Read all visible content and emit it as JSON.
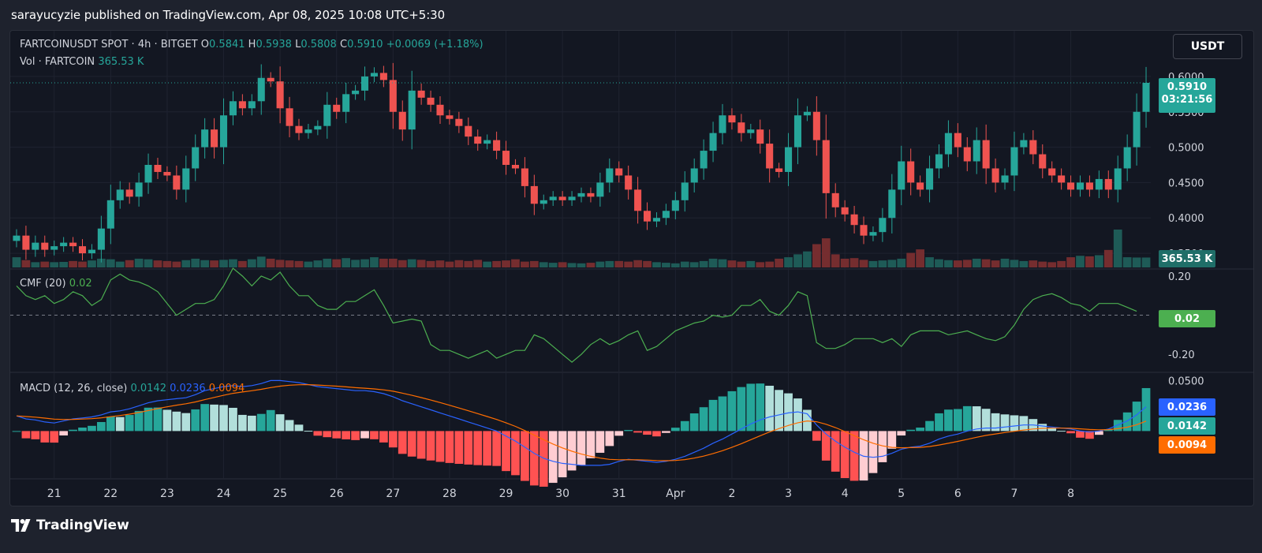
{
  "header": {
    "publisher_line": "sarayucyzie published on TradingView.com, Apr 08, 2025 10:08 UTC+5:30"
  },
  "legend": {
    "symbol": "FARTCOINUSDT SPOT · 4h · BITGET",
    "o_label": "O",
    "o_value": "0.5841",
    "h_label": "H",
    "h_value": "0.5938",
    "l_label": "L",
    "l_value": "0.5808",
    "c_label": "C",
    "c_value": "0.5910",
    "change": "+0.0069 (+1.18%)",
    "vol_label": "Vol · FARTCOIN",
    "vol_value": "365.53 K",
    "cmf_label": "CMF (20)",
    "cmf_value": "0.02",
    "macd_label": "MACD (12, 26, close)",
    "macd_value": "0.0142",
    "signal_value": "0.0236",
    "hist_value": "0.0094"
  },
  "currency_button": "USDT",
  "price_tag": {
    "price": "0.5910",
    "countdown": "03:21:56"
  },
  "volume_tag": "365.53 K",
  "cmf_tag": "0.02",
  "macd_tags": {
    "signal": "0.0236",
    "macd": "0.0142",
    "hist": "0.0094"
  },
  "colors": {
    "up": "#26a69a",
    "down": "#ef5350",
    "cmf": "#4caf50",
    "macd": "#2962ff",
    "signal": "#ff6d00",
    "background": "#131722"
  },
  "footer": {
    "brand": "TradingView"
  },
  "chart_data": [
    {
      "type": "candlestick",
      "title": "FARTCOINUSDT SPOT · 4h · BITGET",
      "y_ticks": [
        "0.6000",
        "0.5500",
        "0.5000",
        "0.4500",
        "0.4000",
        "0.3500"
      ],
      "ylim": [
        0.33,
        0.62
      ],
      "x_ticks": [
        "21",
        "22",
        "23",
        "24",
        "25",
        "26",
        "27",
        "28",
        "29",
        "30",
        "31",
        "Apr",
        "2",
        "3",
        "4",
        "5",
        "6",
        "7",
        "8"
      ],
      "closes": [
        0.375,
        0.355,
        0.365,
        0.355,
        0.36,
        0.365,
        0.36,
        0.35,
        0.355,
        0.385,
        0.425,
        0.44,
        0.43,
        0.45,
        0.475,
        0.465,
        0.46,
        0.44,
        0.47,
        0.5,
        0.525,
        0.5,
        0.545,
        0.565,
        0.555,
        0.565,
        0.598,
        0.593,
        0.555,
        0.53,
        0.52,
        0.525,
        0.53,
        0.56,
        0.55,
        0.575,
        0.58,
        0.6,
        0.605,
        0.595,
        0.55,
        0.525,
        0.58,
        0.57,
        0.56,
        0.545,
        0.54,
        0.53,
        0.515,
        0.505,
        0.51,
        0.495,
        0.475,
        0.47,
        0.445,
        0.42,
        0.425,
        0.43,
        0.425,
        0.43,
        0.435,
        0.43,
        0.45,
        0.47,
        0.46,
        0.44,
        0.41,
        0.395,
        0.4,
        0.41,
        0.425,
        0.45,
        0.47,
        0.495,
        0.52,
        0.545,
        0.535,
        0.52,
        0.525,
        0.505,
        0.47,
        0.465,
        0.5,
        0.545,
        0.55,
        0.51,
        0.435,
        0.415,
        0.405,
        0.39,
        0.375,
        0.38,
        0.4,
        0.44,
        0.48,
        0.45,
        0.44,
        0.47,
        0.49,
        0.52,
        0.5,
        0.48,
        0.51,
        0.47,
        0.45,
        0.46,
        0.5,
        0.51,
        0.49,
        0.47,
        0.46,
        0.45,
        0.44,
        0.45,
        0.44,
        0.455,
        0.44,
        0.47,
        0.5,
        0.55,
        0.591
      ]
    },
    {
      "type": "bar",
      "title": "Vol · FARTCOIN",
      "values": [
        0.35,
        0.25,
        0.18,
        0.2,
        0.18,
        0.19,
        0.22,
        0.2,
        0.24,
        0.3,
        0.28,
        0.2,
        0.25,
        0.3,
        0.28,
        0.24,
        0.22,
        0.2,
        0.25,
        0.3,
        0.25,
        0.24,
        0.26,
        0.28,
        0.22,
        0.28,
        0.37,
        0.3,
        0.26,
        0.24,
        0.22,
        0.2,
        0.24,
        0.3,
        0.28,
        0.32,
        0.26,
        0.28,
        0.35,
        0.3,
        0.3,
        0.25,
        0.28,
        0.26,
        0.22,
        0.24,
        0.2,
        0.25,
        0.22,
        0.26,
        0.2,
        0.22,
        0.24,
        0.28,
        0.2,
        0.22,
        0.18,
        0.16,
        0.18,
        0.15,
        0.14,
        0.16,
        0.2,
        0.22,
        0.22,
        0.2,
        0.25,
        0.22,
        0.18,
        0.16,
        0.14,
        0.2,
        0.18,
        0.22,
        0.3,
        0.28,
        0.24,
        0.2,
        0.22,
        0.18,
        0.2,
        0.3,
        0.35,
        0.45,
        0.55,
        0.8,
        1.0,
        0.45,
        0.3,
        0.32,
        0.26,
        0.22,
        0.24,
        0.26,
        0.3,
        0.5,
        0.62,
        0.35,
        0.28,
        0.25,
        0.24,
        0.26,
        0.3,
        0.28,
        0.24,
        0.3,
        0.26,
        0.22,
        0.24,
        0.2,
        0.18,
        0.22,
        0.35,
        0.4,
        0.38,
        0.42,
        0.6,
        1.3,
        0.35,
        0.34,
        0.34
      ]
    },
    {
      "type": "line",
      "title": "CMF (20)",
      "y_ticks": [
        "0.20",
        "-0.20"
      ],
      "ylim": [
        -0.28,
        0.22
      ],
      "values": [
        0.15,
        0.1,
        0.08,
        0.1,
        0.06,
        0.08,
        0.12,
        0.1,
        0.05,
        0.08,
        0.18,
        0.21,
        0.18,
        0.17,
        0.15,
        0.12,
        0.06,
        0.0,
        0.03,
        0.06,
        0.06,
        0.08,
        0.15,
        0.24,
        0.2,
        0.15,
        0.2,
        0.18,
        0.22,
        0.15,
        0.1,
        0.1,
        0.05,
        0.03,
        0.03,
        0.07,
        0.07,
        0.1,
        0.13,
        0.05,
        -0.04,
        -0.03,
        -0.02,
        -0.03,
        -0.15,
        -0.18,
        -0.18,
        -0.2,
        -0.22,
        -0.2,
        -0.18,
        -0.22,
        -0.2,
        -0.18,
        -0.18,
        -0.1,
        -0.12,
        -0.16,
        -0.2,
        -0.24,
        -0.2,
        -0.15,
        -0.12,
        -0.15,
        -0.13,
        -0.1,
        -0.08,
        -0.18,
        -0.16,
        -0.12,
        -0.08,
        -0.06,
        -0.04,
        -0.03,
        0.0,
        -0.01,
        0.0,
        0.05,
        0.05,
        0.08,
        0.02,
        0.0,
        0.05,
        0.12,
        0.1,
        -0.14,
        -0.17,
        -0.17,
        -0.15,
        -0.12,
        -0.12,
        -0.12,
        -0.14,
        -0.12,
        -0.16,
        -0.1,
        -0.08,
        -0.08,
        -0.08,
        -0.1,
        -0.09,
        -0.08,
        -0.1,
        -0.12,
        -0.13,
        -0.11,
        -0.05,
        0.03,
        0.08,
        0.1,
        0.11,
        0.09,
        0.06,
        0.05,
        0.02,
        0.06,
        0.06,
        0.06,
        0.04,
        0.02
      ]
    },
    {
      "type": "line",
      "title": "MACD (12, 26, close)",
      "y_ticks": [
        "0.0500"
      ],
      "ylim": [
        -0.045,
        0.055
      ],
      "macd": [
        0.015,
        0.012,
        0.011,
        0.009,
        0.008,
        0.01,
        0.012,
        0.013,
        0.014,
        0.016,
        0.019,
        0.02,
        0.022,
        0.025,
        0.028,
        0.03,
        0.031,
        0.032,
        0.033,
        0.036,
        0.04,
        0.042,
        0.044,
        0.045,
        0.044,
        0.045,
        0.047,
        0.05,
        0.05,
        0.049,
        0.048,
        0.046,
        0.044,
        0.043,
        0.042,
        0.041,
        0.04,
        0.04,
        0.039,
        0.037,
        0.034,
        0.03,
        0.027,
        0.024,
        0.021,
        0.018,
        0.015,
        0.012,
        0.009,
        0.006,
        0.003,
        0.0,
        -0.005,
        -0.01,
        -0.016,
        -0.022,
        -0.027,
        -0.03,
        -0.032,
        -0.033,
        -0.034,
        -0.034,
        -0.034,
        -0.033,
        -0.03,
        -0.028,
        -0.029,
        -0.03,
        -0.031,
        -0.03,
        -0.028,
        -0.025,
        -0.021,
        -0.017,
        -0.012,
        -0.008,
        -0.003,
        0.002,
        0.007,
        0.011,
        0.014,
        0.016,
        0.018,
        0.019,
        0.017,
        0.006,
        -0.003,
        -0.01,
        -0.016,
        -0.021,
        -0.025,
        -0.026,
        -0.025,
        -0.022,
        -0.018,
        -0.016,
        -0.015,
        -0.012,
        -0.008,
        -0.005,
        -0.003,
        0.0,
        0.002,
        0.003,
        0.003,
        0.004,
        0.005,
        0.006,
        0.006,
        0.005,
        0.004,
        0.003,
        0.002,
        0.0,
        -0.001,
        0.0,
        0.002,
        0.006,
        0.01,
        0.016,
        0.024
      ]
    }
  ]
}
